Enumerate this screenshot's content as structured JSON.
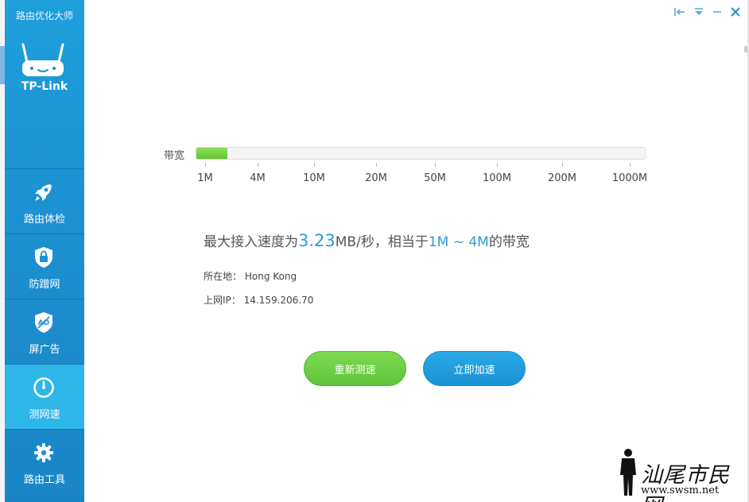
{
  "app": {
    "title": "路由优化大师",
    "brand": "TP-Link"
  },
  "window_controls": [
    {
      "name": "pin-icon"
    },
    {
      "name": "menu-icon"
    },
    {
      "name": "minimize-icon"
    },
    {
      "name": "close-icon"
    }
  ],
  "sidebar": {
    "items": [
      {
        "label": "路由体检",
        "icon": "rocket-icon",
        "active": false
      },
      {
        "label": "防蹭网",
        "icon": "shield-lock-icon",
        "active": false
      },
      {
        "label": "屏广告",
        "icon": "ad-block-icon",
        "active": false
      },
      {
        "label": "测网速",
        "icon": "speedometer-icon",
        "active": true
      },
      {
        "label": "路由工具",
        "icon": "gear-icon",
        "active": false
      }
    ]
  },
  "bandwidth": {
    "label": "带宽",
    "fill_fraction": 0.07,
    "ticks": [
      "1M",
      "4M",
      "10M",
      "20M",
      "50M",
      "100M",
      "200M",
      "1000M"
    ]
  },
  "result": {
    "prefix": "最大接入速度为",
    "speed": "3.23",
    "unit": "MB/秒，相当于",
    "range": "1M ~ 4M",
    "suffix": "的带宽"
  },
  "info": {
    "location_label": "所在地：",
    "location_value": "Hong Kong",
    "ip_label": "上网IP：",
    "ip_value": "14.159.206.70"
  },
  "buttons": {
    "retest": "重新测速",
    "speedup": "立即加速"
  },
  "watermark": {
    "text": "汕尾市民网",
    "url": "www.swsm.net"
  },
  "colors": {
    "sidebar": "#1d92d2",
    "active_item": "#2fb6e8",
    "accent": "#2a9cd8",
    "green": "#62c72f"
  }
}
